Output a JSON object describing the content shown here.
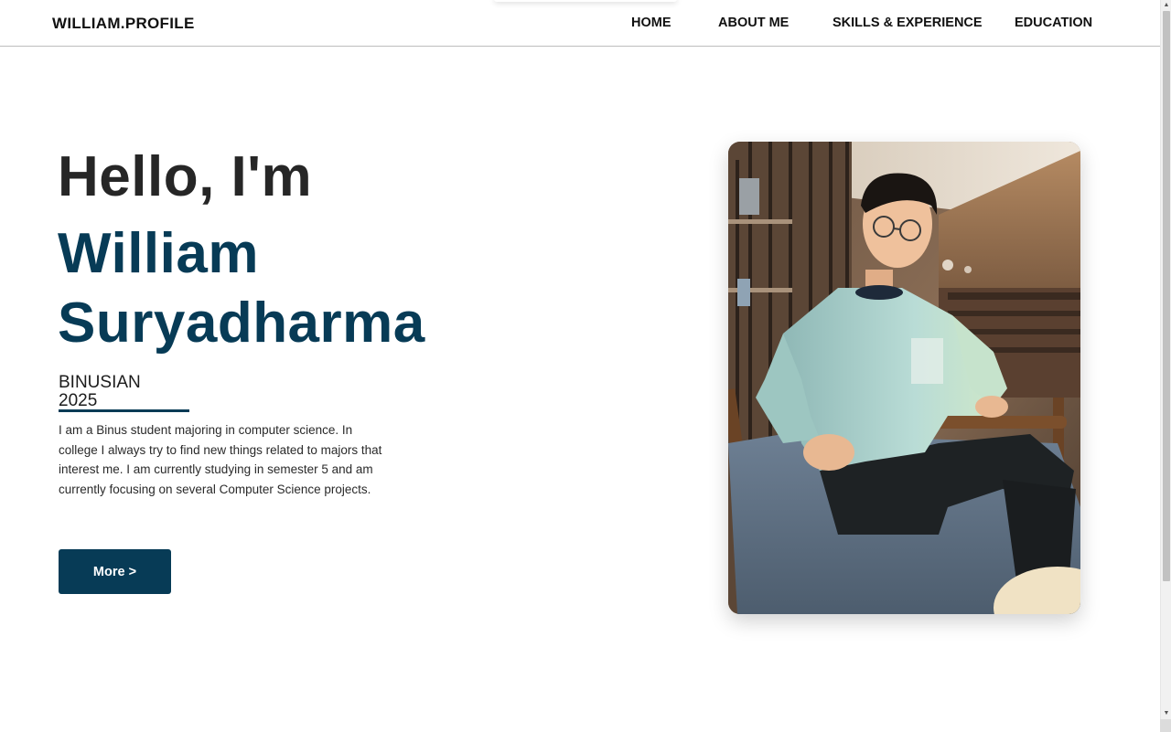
{
  "navbar": {
    "brand": "WILLIAM.PROFILE",
    "links": [
      "HOME",
      "ABOUT ME",
      "SKILLS & EXPERIENCE",
      "EDUCATION"
    ]
  },
  "hero": {
    "greeting": "Hello, I'm",
    "first_name": "William",
    "last_name": "Suryadharma",
    "tagline_line1": "BINUSIAN",
    "tagline_line2": "2025",
    "bio": "I am a Binus student majoring in computer science. In college I always try to find new things related to majors that interest me. I am currently studying in semester 5 and am currently focusing on several Computer Science projects.",
    "more_button": "More >"
  },
  "colors": {
    "accent": "#073b56",
    "text_dark": "#262626",
    "background": "#ffffff"
  },
  "photo": {
    "icon": "profile-photo"
  },
  "scrollbars": {
    "up_arrow": "▲",
    "down_arrow": "▼",
    "left_arrow": "◀",
    "right_arrow": "▶"
  }
}
